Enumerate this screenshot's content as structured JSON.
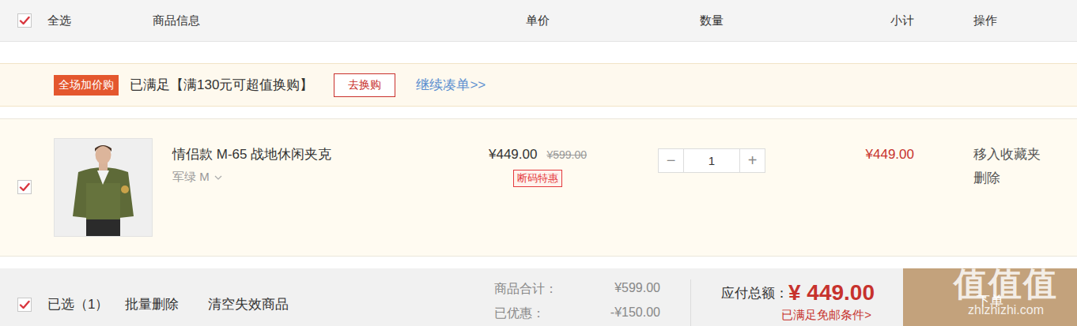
{
  "header": {
    "select_all": {
      "label": "全选",
      "checked": true
    },
    "columns": [
      "商品信息",
      "单价",
      "数量",
      "小计",
      "操作"
    ]
  },
  "promo": {
    "badge": "全场加价购",
    "message": "已满足【满130元可超值换购】",
    "button": "去换购",
    "link": "继续凑单>>"
  },
  "items": [
    {
      "checked": true,
      "title": "情侣款 M-65 战地休闲夹克",
      "variant": "军绿 M",
      "price": "¥449.00",
      "original_price": "¥599.00",
      "tag": "断码特惠",
      "minus": "−",
      "quantity": "1",
      "plus": "+",
      "subtotal": "¥449.00",
      "actions": [
        "移入收藏夹",
        "删除"
      ]
    }
  ],
  "footer": {
    "selected": {
      "label": "已选（1）",
      "checked": true
    },
    "links": [
      "批量删除",
      "清空失效商品"
    ],
    "summary": [
      {
        "label": "商品合计：",
        "value": "¥599.00"
      },
      {
        "label": "已优惠：",
        "value": "-¥150.00"
      }
    ],
    "total_label": "应付总额：",
    "total": "¥ 449.00",
    "shipping": "已满足免邮条件>",
    "checkout": "下单"
  },
  "watermark": {
    "logo": "值值值",
    "site": "zhizhizhi.com"
  }
}
